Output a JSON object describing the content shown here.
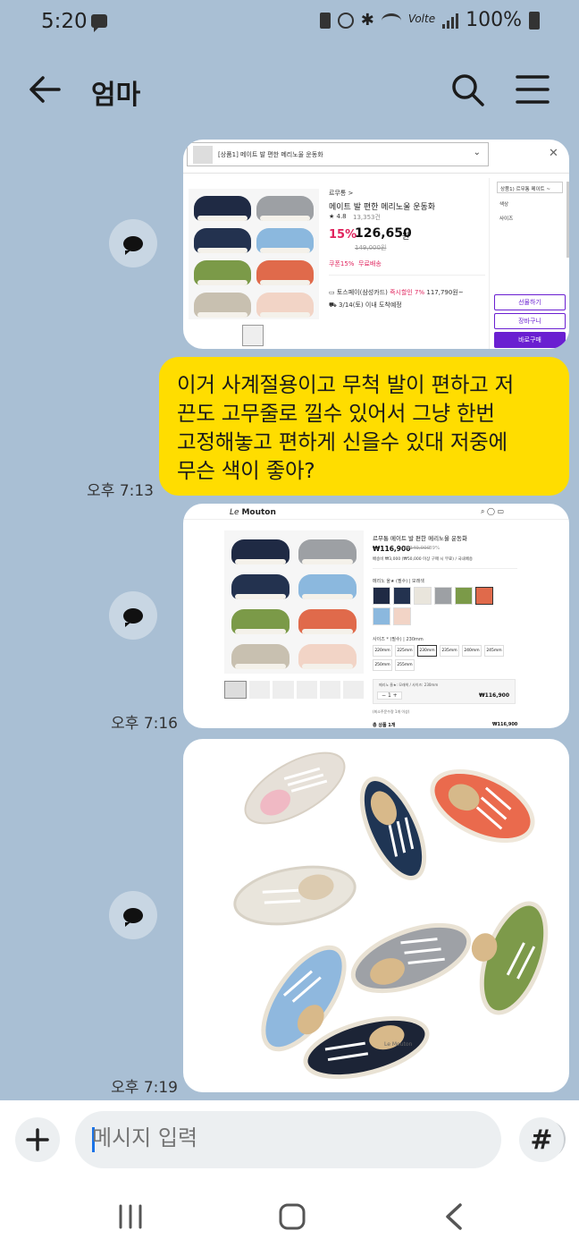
{
  "status_bar": {
    "time": "5:20",
    "battery": "100%",
    "volte": "Volte"
  },
  "header": {
    "title": "엄마"
  },
  "messages": [
    {
      "type": "image",
      "content": "product_screenshot_1",
      "shop": {
        "dropdown": "[상품1] 메이트 발 편한 메리노울 운동화",
        "brand": "르무통 >",
        "product": "메이트 발 편한 메리노울 운동화",
        "rating": "★ 4.8",
        "reviews": "13,353건",
        "discount": "15%",
        "price": "126,650",
        "price_unit": "원",
        "orig_price": "149,000원",
        "coupon": "쿠폰15%",
        "shipping": "무료배송",
        "card_info_prefix": "토스페이(삼성카드)",
        "card_info_highlight": "즉시할인 7%",
        "card_info_suffix": "117,790원~",
        "delivery": "3/14(토) 이내 도착예정",
        "side_option1": "상품1) 르무통 메이트 ~",
        "side_option2": "색상",
        "side_option3": "사이즈",
        "btn_gift": "선물하기",
        "btn_cart": "장바구니",
        "btn_buy": "바로구매"
      }
    },
    {
      "type": "text",
      "text_lines": [
        "이거 사계절용이고 무척 발이 편하고 저",
        "끈도 고무줄로 낄수 있어서 그냥 한번",
        "고정해놓고 편하게 신을수 있대  저중에",
        "무슨 색이 좋아?"
      ],
      "time": "오후 7:13"
    },
    {
      "type": "image",
      "content": "product_screenshot_2",
      "time": "오후 7:16",
      "shop": {
        "logo_prefix": "Le",
        "logo": "Mouton",
        "product": "르무통 메이트 발 편한 메리노울 운동화",
        "price": "₩116,900",
        "orig_price": "₩149,000",
        "discount": "39%",
        "shipping": "배송비 ₩3,000 (₩50,000 이상 구매 시 무료) / 국내배송",
        "color_label": "메리노 울★ (필수)",
        "color_value": "모래색",
        "size_label": "사이즈 * (필수)",
        "size_value": "230mm",
        "sizes": [
          "220mm",
          "225mm",
          "230mm",
          "235mm",
          "240mm",
          "245mm",
          "250mm",
          "255mm"
        ],
        "selected": "메리노 울★: 모래색 / 사이즈: 230mm",
        "qty": "1",
        "line_total": "₩116,900",
        "note": "(최소주문수량 1개 이상)",
        "total_label": "총 상품 1개",
        "total": "₩116,900"
      }
    },
    {
      "type": "image",
      "content": "shoes_photo",
      "time": "오후 7:19",
      "brand": "Le Mouton"
    }
  ],
  "input": {
    "placeholder": "메시지 입력"
  },
  "colors": {
    "background": "#a9bfd4",
    "my_bubble": "#ffdd00",
    "discount_red": "#e0245e",
    "buy_purple": "#6a1fd1"
  }
}
